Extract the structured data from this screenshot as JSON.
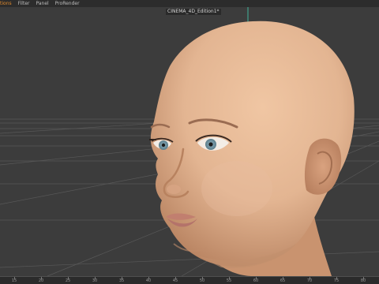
{
  "menu": {
    "items": [
      {
        "label": "tions",
        "active": true
      },
      {
        "label": "Filter",
        "active": false
      },
      {
        "label": "Panel",
        "active": false
      },
      {
        "label": "ProRender",
        "active": false
      }
    ]
  },
  "viewport": {
    "title": "CINEMA_4D_Edition1*"
  },
  "timeline": {
    "labels": [
      "15",
      "20",
      "25",
      "30",
      "35",
      "40",
      "45",
      "50",
      "55",
      "60",
      "65",
      "70",
      "75",
      "80"
    ]
  },
  "colors": {
    "accent": "#e08a2c",
    "axis_y": "#3fb59b",
    "skin": "#e3b592"
  }
}
